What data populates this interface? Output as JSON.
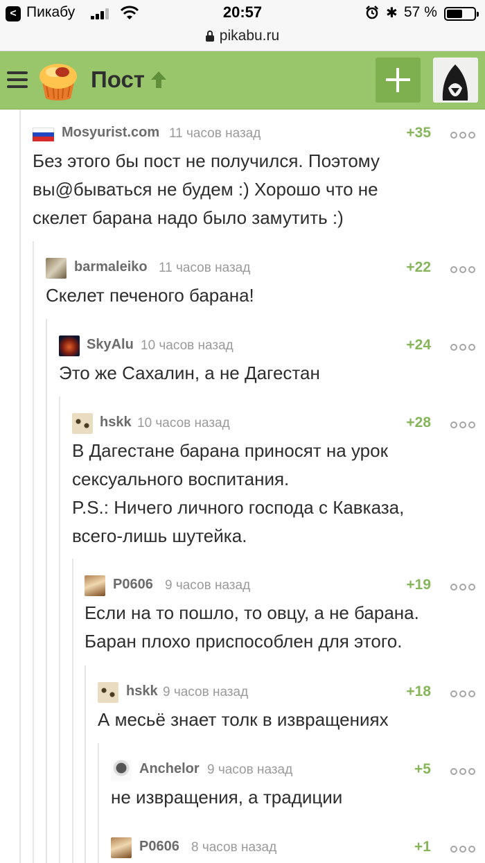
{
  "status_bar": {
    "back_glyph": "<",
    "carrier": "Пикабу",
    "time": "20:57",
    "battery_text": "57 %",
    "battery_level": 0.57
  },
  "url_bar": {
    "url": "pikabu.ru"
  },
  "header": {
    "title": "Пост",
    "accent_color": "#99c66b",
    "rating_color": "#86b55a"
  },
  "comments": [
    {
      "author": "Mosyurist.com",
      "time": "11 часов назад",
      "rating": "+35",
      "text": [
        "Без этого бы пост не получился. Поэтому",
        "вы@быватьcя не будем :) Хорошо что не",
        "скелет барана надо было замутить :)"
      ]
    },
    {
      "author": "barmaleiko",
      "time": "11 часов назад",
      "rating": "+22",
      "text": [
        "Скелет печеного барана!"
      ]
    },
    {
      "author": "SkyAlu",
      "time": "10 часов назад",
      "rating": "+24",
      "text": [
        "Это же Сахалин, а не Дагестан"
      ]
    },
    {
      "author": "hskk",
      "time": "10 часов назад",
      "rating": "+28",
      "text": [
        "В Дагестане барана приносят на урок",
        "сексуального воспитания.",
        "P.S.: Ничего личного господа с Кавказа,",
        "всего-лишь шутейка."
      ]
    },
    {
      "author": "P0606",
      "time": "9 часов назад",
      "rating": "+19",
      "text": [
        "Если на то пошло, то овцу, а не барана.",
        "Баран плохо приспособлен для этого."
      ]
    },
    {
      "author": "hskk",
      "time": "9 часов назад",
      "rating": "+18",
      "text": [
        "А месьё знает толк в извращениях"
      ]
    },
    {
      "author": "Anchelor",
      "time": "9 часов назад",
      "rating": "+5",
      "text": [
        "не извращения, а традиции"
      ]
    },
    {
      "author": "P0606",
      "time": "8 часов назад",
      "rating": "+1",
      "text": []
    }
  ]
}
